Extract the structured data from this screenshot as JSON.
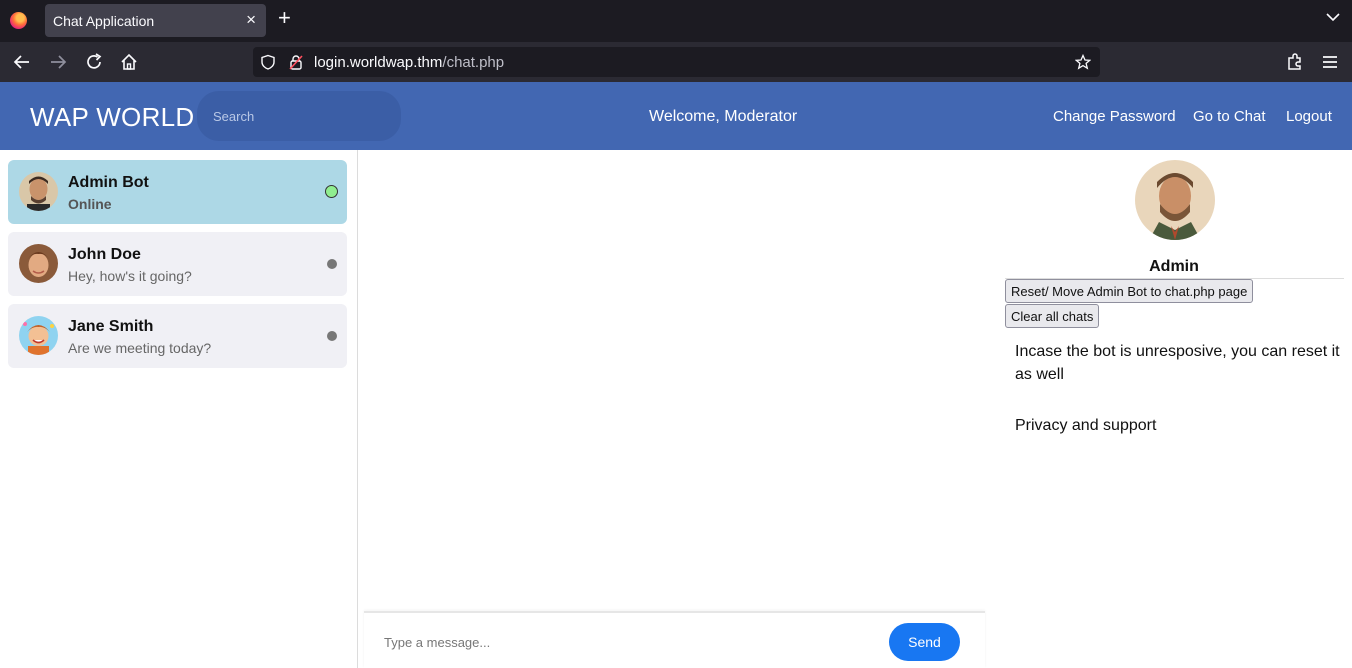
{
  "browser": {
    "tab_title": "Chat Application",
    "tab_close": "×",
    "new_tab": "+",
    "url_host": "login.worldwap.thm",
    "url_path": "/chat.php"
  },
  "header": {
    "brand": "WAP WORLD",
    "search_placeholder": "Search",
    "welcome": "Welcome, Moderator",
    "links": [
      "Change Password",
      "Go to Chat",
      "Logout"
    ]
  },
  "contacts": [
    {
      "name": "Admin Bot",
      "message": "Online",
      "status": "online",
      "avatar": "admin-bot-avatar"
    },
    {
      "name": "John Doe",
      "message": "Hey, how's it going?",
      "status": "offline",
      "avatar": "john-doe-avatar"
    },
    {
      "name": "Jane Smith",
      "message": "Are we meeting today?",
      "status": "offline",
      "avatar": "jane-smith-avatar"
    }
  ],
  "composer": {
    "placeholder": "Type a message...",
    "send_label": "Send"
  },
  "panel": {
    "name": "Admin",
    "reset_label": "Reset/ Move Admin Bot to chat.php page",
    "clear_label": "Clear all chats",
    "note": "Incase the bot is unresposive, you can reset it as well",
    "privacy": "Privacy and support"
  },
  "colors": {
    "header_bg": "#4267b2",
    "active_contact": "#add8e6",
    "send_button": "#1877f2",
    "online_dot": "#90ee90"
  }
}
